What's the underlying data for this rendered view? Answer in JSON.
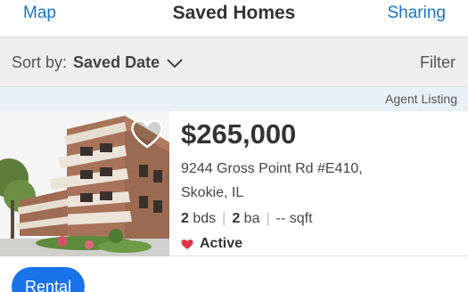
{
  "header": {
    "left_link": "Map",
    "title": "Saved Homes",
    "right_link": "Sharing"
  },
  "sortbar": {
    "label": "Sort by:",
    "value": "Saved Date",
    "filter_label": "Filter"
  },
  "agent_label": "Agent Listing",
  "listing": {
    "price": "$265,000",
    "address_line1": "9244 Gross Point Rd #E410,",
    "address_line2": "Skokie, IL",
    "beds": "2",
    "beds_unit": "bds",
    "baths": "2",
    "baths_unit": "ba",
    "sqft": "--",
    "sqft_unit": "sqft",
    "status": "Active",
    "photo_icon": "apartment-building-photo"
  },
  "rental_button": "Rental",
  "colors": {
    "accent": "#1a73c9",
    "button": "#1a73e8",
    "status_heart": "#e0334a"
  }
}
